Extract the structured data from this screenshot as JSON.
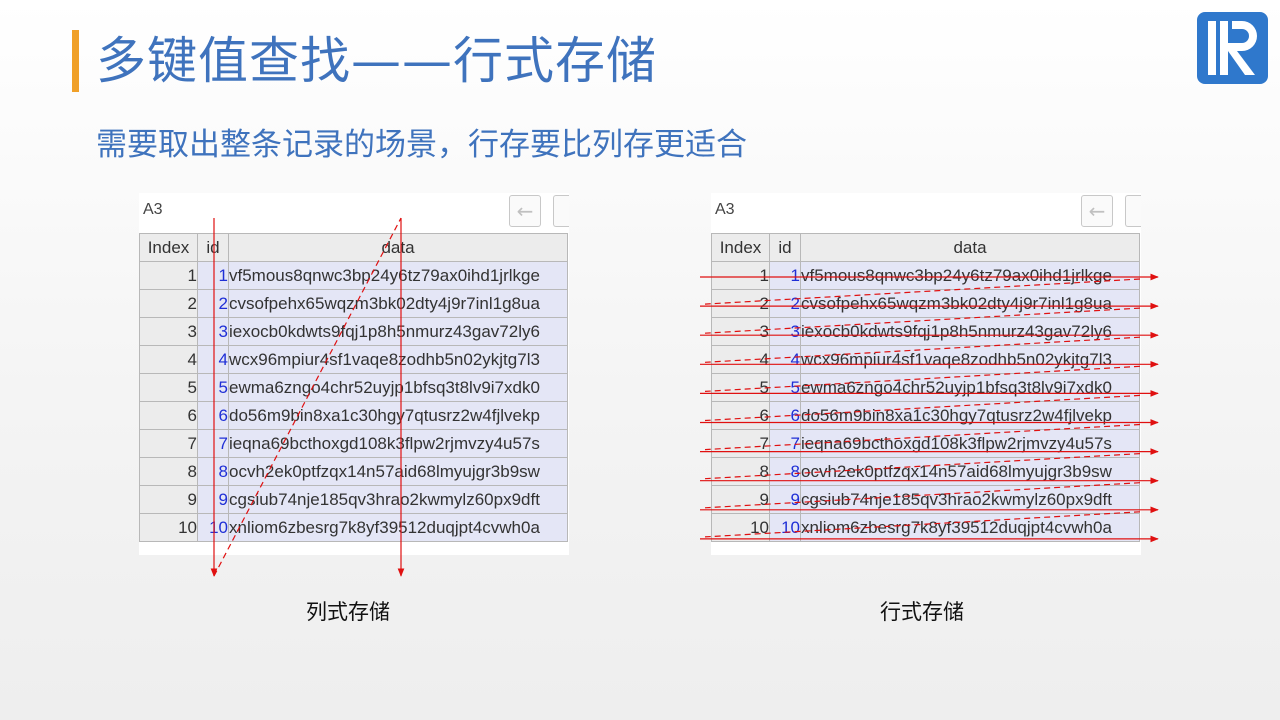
{
  "header": {
    "title": "多键值查找——行式存储",
    "subtitle": "需要取出整条记录的场景，行存要比列存更适合"
  },
  "accent_color": "#f0a028",
  "text_color": "#3f73bd",
  "logo": {
    "icon": "raqsoft-r-logo",
    "color": "#2f78cc"
  },
  "arrow_color": "#e01010",
  "panels": [
    {
      "key": "left",
      "cell_ref": "A3",
      "caption": "列式存储",
      "arrows": "column-wise"
    },
    {
      "key": "right",
      "cell_ref": "A3",
      "caption": "行式存储",
      "arrows": "row-wise"
    }
  ],
  "table": {
    "columns": [
      "Index",
      "id",
      "data"
    ],
    "rows": [
      [
        "1",
        "1",
        "vf5mous8qnwc3bp24y6tz79ax0ihd1jrlkge"
      ],
      [
        "2",
        "2",
        "cvsofpehx65wqzm3bk02dty4j9r7inl1g8ua"
      ],
      [
        "3",
        "3",
        "iexocb0kdwts9fqj1p8h5nmurz43gav72ly6"
      ],
      [
        "4",
        "4",
        "wcx96mpiur4sf1vaqe8zodhb5n02ykjtg7l3"
      ],
      [
        "5",
        "5",
        "ewma6zngo4chr52uyjp1bfsq3t8lv9i7xdk0"
      ],
      [
        "6",
        "6",
        "do56m9bin8xa1c30hgy7qtusrz2w4fjlvekp"
      ],
      [
        "7",
        "7",
        "ieqna69bcthoxgd108k3flpw2rjmvzy4u57s"
      ],
      [
        "8",
        "8",
        "ocvh2ek0ptfzqx14n57aid68lmyujgr3b9sw"
      ],
      [
        "9",
        "9",
        "cgsiub74nje185qv3hrao2kwmylz60px9dft"
      ],
      [
        "10",
        "10",
        "xnliom6zbesrg7k8yf39512duqjpt4cvwh0a"
      ]
    ]
  }
}
